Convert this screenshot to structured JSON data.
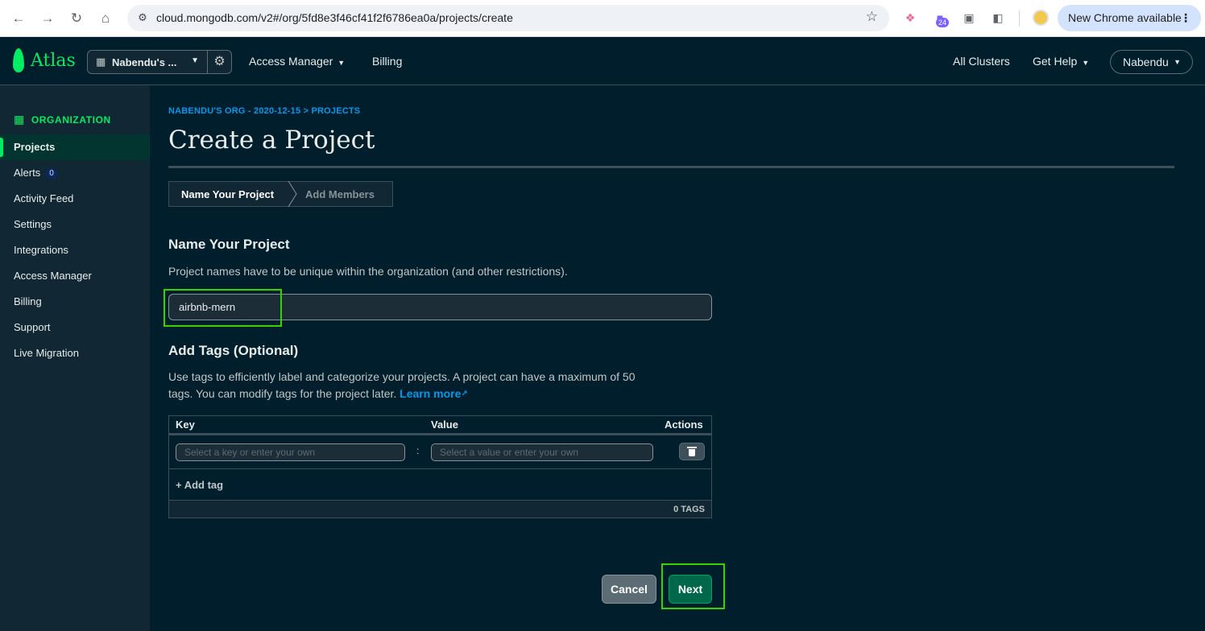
{
  "browser": {
    "url": "cloud.mongodb.com/v2#/org/5fd8e3f46cf41f2f6786ea0a/projects/create",
    "extension_badge": "24",
    "update_label": "New Chrome available"
  },
  "header": {
    "logo_text": "Atlas",
    "org_name": "Nabendu's ...",
    "nav": {
      "access_manager": "Access Manager",
      "billing": "Billing",
      "all_clusters": "All Clusters",
      "get_help": "Get Help"
    },
    "user": "Nabendu"
  },
  "sidebar": {
    "heading": "ORGANIZATION",
    "items": [
      {
        "label": "Projects"
      },
      {
        "label": "Alerts",
        "badge": "0"
      },
      {
        "label": "Activity Feed"
      },
      {
        "label": "Settings"
      },
      {
        "label": "Integrations"
      },
      {
        "label": "Access Manager"
      },
      {
        "label": "Billing"
      },
      {
        "label": "Support"
      },
      {
        "label": "Live Migration"
      }
    ]
  },
  "main": {
    "breadcrumb": "NABENDU'S ORG - 2020-12-15 > PROJECTS",
    "title": "Create a Project",
    "steps": [
      "Name Your Project",
      "Add Members"
    ],
    "name_section": {
      "heading": "Name Your Project",
      "description": "Project names have to be unique within the organization (and other restrictions).",
      "input_value": "airbnb-mern"
    },
    "tags_section": {
      "heading": "Add Tags (Optional)",
      "description_line1": "Use tags to efficiently label and categorize your projects. A project can have a maximum of 50",
      "description_line2": "tags. You can modify tags for the project later.",
      "learn_more": "Learn more",
      "columns": {
        "key": "Key",
        "value": "Value",
        "actions": "Actions"
      },
      "key_placeholder": "Select a key or enter your own",
      "value_placeholder": "Select a value or enter your own",
      "separator": ":",
      "add_tag": "+ Add tag",
      "count": "0 TAGS"
    },
    "buttons": {
      "cancel": "Cancel",
      "next": "Next"
    }
  },
  "colors": {
    "accent": "#00ed64",
    "background": "#001e2b",
    "sidebar": "#112733",
    "link": "#0498ec",
    "primary_button": "#00684a",
    "highlight": "#35d300"
  },
  "icons": {
    "back": "arrow-left-icon",
    "forward": "arrow-right-icon",
    "reload": "reload-icon",
    "home": "home-icon",
    "site_info": "tune-icon",
    "bookmark": "star-icon",
    "org": "building-icon",
    "settings": "gear-icon",
    "delete": "trash-icon",
    "external": "external-link-icon"
  }
}
